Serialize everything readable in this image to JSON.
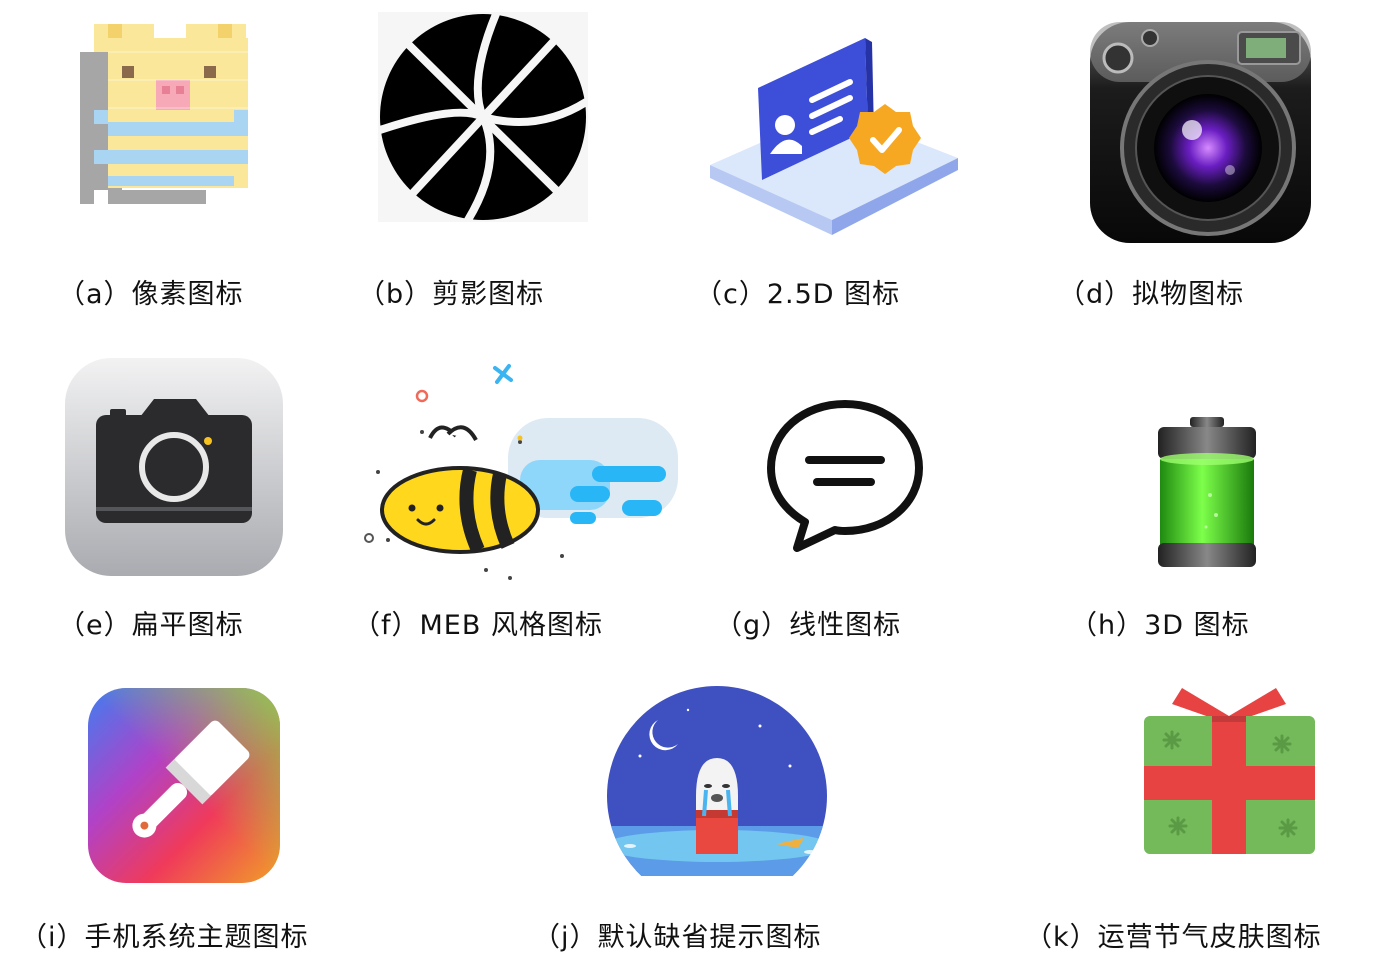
{
  "gallery": {
    "items": [
      {
        "id": "a",
        "caption": "（a）像素图标",
        "icon": "pixel-pig-icon"
      },
      {
        "id": "b",
        "caption": "（b）剪影图标",
        "icon": "basketball-silhouette-icon"
      },
      {
        "id": "c",
        "caption": "（c）2.5D 图标",
        "icon": "id-card-verified-icon"
      },
      {
        "id": "d",
        "caption": "（d）拟物图标",
        "icon": "realistic-camera-icon"
      },
      {
        "id": "e",
        "caption": "（e）扁平图标",
        "icon": "flat-camera-icon"
      },
      {
        "id": "f",
        "caption": "（f）MEB 风格图标",
        "icon": "bee-icon"
      },
      {
        "id": "g",
        "caption": "（g）线性图标",
        "icon": "chat-bubble-icon"
      },
      {
        "id": "h",
        "caption": "（h）3D 图标",
        "icon": "battery-icon"
      },
      {
        "id": "i",
        "caption": "（i）手机系统主题图标",
        "icon": "theme-brush-icon"
      },
      {
        "id": "j",
        "caption": "（j）默认缺省提示图标",
        "icon": "crying-ghost-icon"
      },
      {
        "id": "k",
        "caption": "（k）运营节气皮肤图标",
        "icon": "gift-box-icon"
      }
    ]
  },
  "colors": {
    "pixel_yellow": "#fbe79a",
    "pixel_blue": "#a9d4f2",
    "pixel_pink": "#f7a9b8",
    "pixel_gray": "#a6a6a6",
    "card_blue": "#3d4ed8",
    "badge_orange": "#f7a823",
    "battery_green": "#3bd11a",
    "bee_yellow": "#ffd81d",
    "bee_blue": "#29b6f6",
    "gift_green": "#74b95a",
    "gift_red": "#e74343",
    "night_blue": "#3f51c1"
  }
}
